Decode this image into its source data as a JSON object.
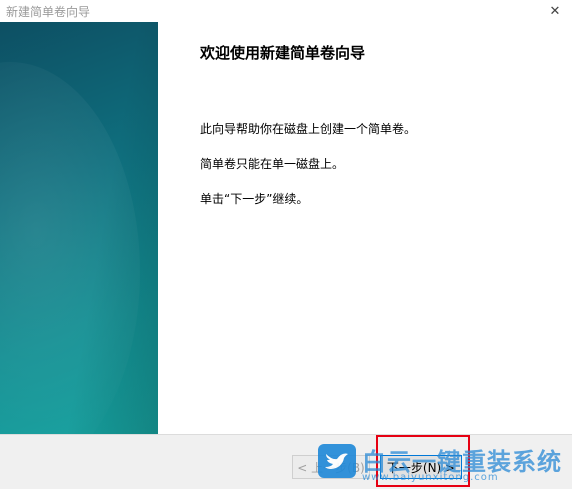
{
  "window": {
    "title": "新建简单卷向导",
    "close_glyph": "✕"
  },
  "content": {
    "heading": "欢迎使用新建简单卷向导",
    "para1": "此向导帮助你在磁盘上创建一个简单卷。",
    "para2": "简单卷只能在单一磁盘上。",
    "para3": "单击“下一步”继续。"
  },
  "footer": {
    "back_label": "< 上一步(B)",
    "next_label": "下一步(N) >"
  },
  "watermark": {
    "main": "白云一键重装系统",
    "sub": "www.baiyunxitong.com"
  },
  "colors": {
    "highlight": "#e60012",
    "panel": "#0f6f7e"
  }
}
